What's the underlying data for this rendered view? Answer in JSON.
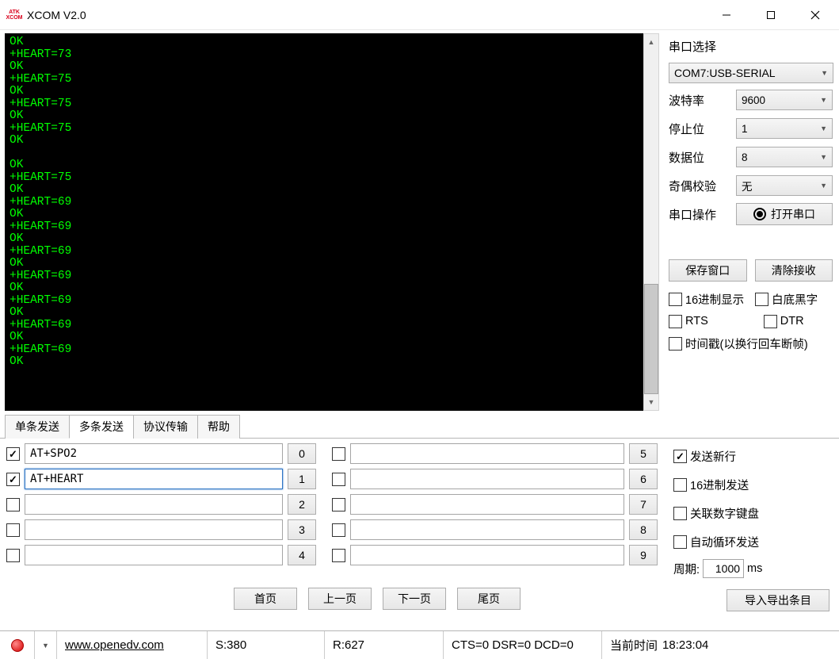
{
  "title": "XCOM V2.0",
  "logo": {
    "line1": "ATK",
    "line2": "XCOM"
  },
  "console_lines": [
    "OK",
    "+HEART=73",
    "OK",
    "+HEART=75",
    "OK",
    "+HEART=75",
    "OK",
    "+HEART=75",
    "OK",
    "",
    "OK",
    "+HEART=75",
    "OK",
    "+HEART=69",
    "OK",
    "+HEART=69",
    "OK",
    "+HEART=69",
    "OK",
    "+HEART=69",
    "OK",
    "+HEART=69",
    "OK",
    "+HEART=69",
    "OK",
    "+HEART=69",
    "OK"
  ],
  "side": {
    "title": "串口选择",
    "port": "COM7:USB-SERIAL",
    "baud_label": "波特率",
    "baud": "9600",
    "stop_label": "停止位",
    "stop": "1",
    "data_label": "数据位",
    "data_bits": "8",
    "parity_label": "奇偶校验",
    "parity": "无",
    "op_label": "串口操作",
    "open_btn": "打开串口",
    "save_btn": "保存窗口",
    "clear_btn": "清除接收",
    "chk_hex_display": "16进制显示",
    "chk_white_bg": "白底黑字",
    "chk_rts": "RTS",
    "chk_dtr": "DTR",
    "chk_timestamp": "时间戳(以换行回车断帧)"
  },
  "tabs": {
    "single": "单条发送",
    "multi": "多条发送",
    "protocol": "协议传输",
    "help": "帮助"
  },
  "send": {
    "left": [
      {
        "checked": true,
        "text": "AT+SPO2",
        "num": "0"
      },
      {
        "checked": true,
        "text": "AT+HEART",
        "num": "1",
        "highlight": true
      },
      {
        "checked": false,
        "text": "",
        "num": "2"
      },
      {
        "checked": false,
        "text": "",
        "num": "3"
      },
      {
        "checked": false,
        "text": "",
        "num": "4"
      }
    ],
    "right": [
      {
        "checked": false,
        "text": "",
        "num": "5"
      },
      {
        "checked": false,
        "text": "",
        "num": "6"
      },
      {
        "checked": false,
        "text": "",
        "num": "7"
      },
      {
        "checked": false,
        "text": "",
        "num": "8"
      },
      {
        "checked": false,
        "text": "",
        "num": "9"
      }
    ],
    "opts": {
      "send_newline": "发送新行",
      "hex_send": "16进制发送",
      "numpad": "关联数字键盘",
      "auto_loop": "自动循环发送",
      "period_label": "周期:",
      "period_value": "1000",
      "period_unit": "ms"
    },
    "nav": {
      "first": "首页",
      "prev": "上一页",
      "next": "下一页",
      "last": "尾页",
      "import": "导入导出条目"
    }
  },
  "status": {
    "url": "www.openedv.com",
    "s": "S:380",
    "r": "R:627",
    "signals": "CTS=0 DSR=0 DCD=0",
    "time_label": "当前时间",
    "time": "18:23:04"
  }
}
